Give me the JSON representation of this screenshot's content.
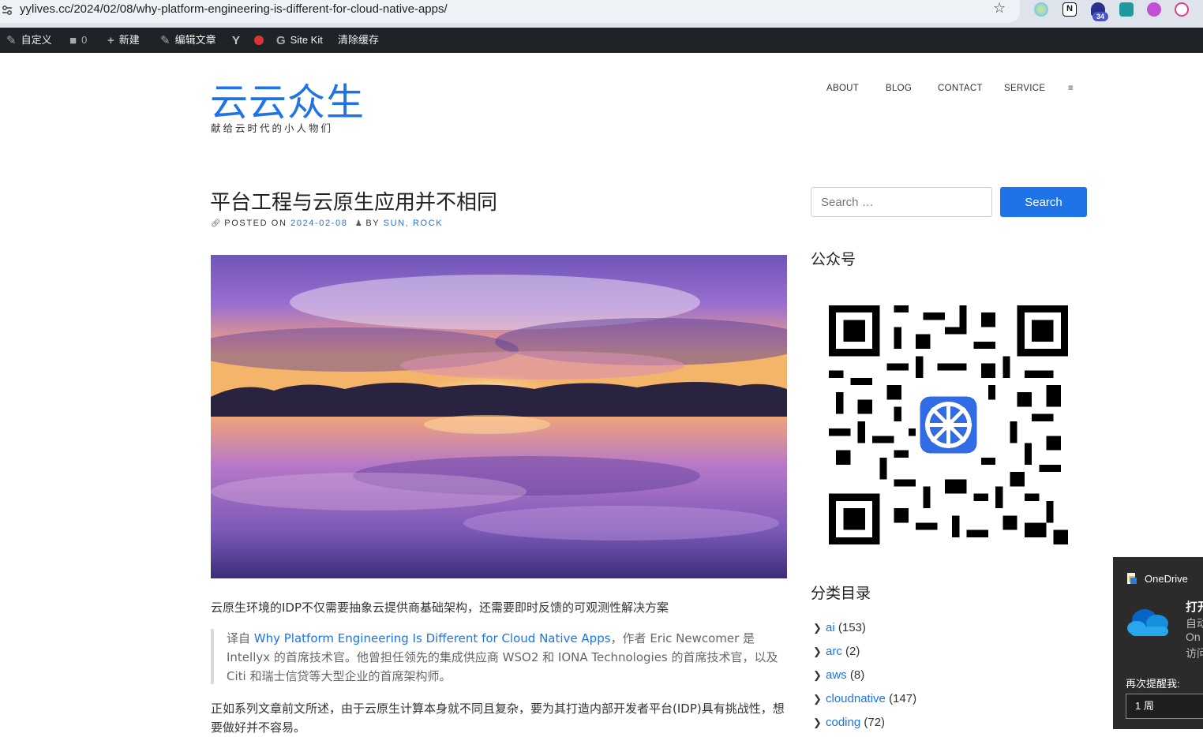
{
  "browser": {
    "url": "yylives.cc/2024/02/08/why-platform-engineering-is-different-for-cloud-native-apps/",
    "extension_badge": "34"
  },
  "admin_bar": {
    "customize": "自定义",
    "comments_count": "0",
    "new": "新建",
    "edit": "编辑文章",
    "site_kit": "Site Kit",
    "clear_cache": "清除缓存"
  },
  "site": {
    "title": "云云众生",
    "description": "献给云时代的小人物们",
    "nav": [
      "ABOUT",
      "BLOG",
      "CONTACT",
      "SERVICE",
      "≡"
    ]
  },
  "post": {
    "title": "平台工程与云原生应用并不相同",
    "posted_on_label": "POSTED ON",
    "date": "2024-02-08",
    "by_label": "BY",
    "authors": "SUN, ROCK",
    "lead": "云原生环境的IDP不仅需要抽象云提供商基础架构，还需要即时反馈的可观测性解决方案",
    "quote_prefix": "译自 ",
    "quote_link": "Why Platform Engineering Is Different for Cloud Native Apps",
    "quote_rest": "，作者 Eric Newcomer 是 Intellyx 的首席技术官。他曾担任领先的集成供应商 WSO2 和 IONA Technologies 的首席技术官，以及 Citi 和瑞士信贷等大型企业的首席架构师。",
    "body": "正如系列文章前文所述，由于云原生计算本身就不同且复杂，要为其打造内部开发者平台(IDP)具有挑战性，想要做好并不容易。"
  },
  "sidebar": {
    "search_placeholder": "Search …",
    "search_button": "Search",
    "wechat_title": "公众号",
    "categories_title": "分类目录",
    "categories": [
      {
        "name": "ai",
        "count": "(153)"
      },
      {
        "name": "arc",
        "count": "(2)"
      },
      {
        "name": "aws",
        "count": "(8)"
      },
      {
        "name": "cloudnative",
        "count": "(147)"
      },
      {
        "name": "coding",
        "count": "(72)"
      }
    ]
  },
  "toast": {
    "app": "OneDrive",
    "heading": "打开",
    "line1": "自动",
    "line2": "On",
    "line3": "访问",
    "remind_label": "再次提醒我:",
    "remind_value": "1 周"
  },
  "colors": {
    "accent": "#1e73e8",
    "admin_bar": "#1d2327",
    "toast_bg": "#2b2b2b"
  }
}
